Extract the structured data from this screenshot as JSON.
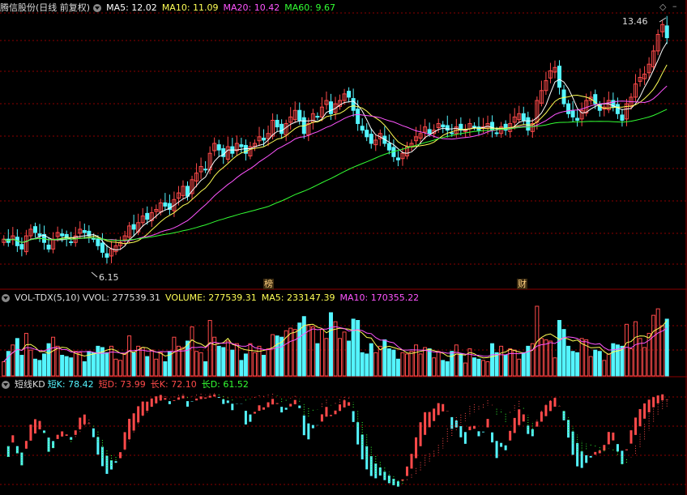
{
  "header": {
    "stock": "腾信股份(日线 前复权)",
    "ma5": "MA5: 12.02",
    "ma10": "MA10: 11.09",
    "ma20": "MA20: 10.42",
    "ma60": "MA60: 9.67"
  },
  "volume_header": {
    "name": "VOL-TDX(5,10)",
    "vvol": "VVOL: 277539.31",
    "volume": "VOLUME: 277539.31",
    "ma5": "MA5: 233147.39",
    "ma10": "MA10: 170355.22"
  },
  "kd_header": {
    "name": "短线KD",
    "shortk": "短K: 78.42",
    "shortd": "短D: 73.99",
    "longk": "长K: 72.10",
    "longd": "长D: 61.52"
  },
  "price_labels": {
    "high": "13.46",
    "low": "6.15"
  },
  "markers": {
    "bang": "榜",
    "cai": "财"
  },
  "controls": {
    "diamond": "◇",
    "minus": "–"
  },
  "colors": {
    "up": "#ff4a4a",
    "down": "#54f5ff",
    "ma5": "#ffffff",
    "ma10": "#ffff55",
    "ma20": "#ff55ff",
    "ma60": "#33ff33",
    "grid": "#8b0000"
  },
  "chart_data": [
    {
      "type": "candlestick",
      "title": "腾信股份(日线 前复权)",
      "series": [
        {
          "name": "MA5",
          "values": [
            12.02
          ]
        },
        {
          "name": "MA10",
          "values": [
            11.09
          ]
        },
        {
          "name": "MA20",
          "values": [
            10.42
          ]
        },
        {
          "name": "MA60",
          "values": [
            9.67
          ]
        }
      ],
      "close": [
        6.7,
        6.6,
        6.8,
        6.5,
        6.4,
        6.8,
        7.0,
        6.9,
        6.8,
        6.6,
        6.4,
        6.7,
        6.9,
        6.8,
        6.7,
        6.6,
        6.8,
        7.0,
        6.9,
        6.8,
        6.7,
        6.5,
        6.3,
        6.15,
        6.4,
        6.5,
        6.6,
        6.8,
        7.1,
        7.0,
        7.2,
        7.4,
        7.3,
        7.5,
        7.6,
        7.8,
        7.7,
        7.6,
        7.9,
        8.1,
        8.3,
        8.0,
        8.5,
        8.7,
        8.9,
        8.8,
        9.3,
        9.6,
        9.4,
        9.2,
        9.5,
        9.3,
        9.6,
        9.5,
        9.3,
        9.5,
        9.6,
        9.8,
        9.7,
        9.9,
        10.3,
        10.1,
        9.9,
        10.2,
        10.4,
        10.6,
        10.3,
        9.9,
        10.2,
        10.5,
        10.4,
        10.7,
        10.9,
        10.5,
        10.8,
        10.9,
        11.1,
        11.0,
        10.6,
        10.2,
        10.0,
        9.8,
        9.6,
        9.7,
        9.9,
        9.6,
        9.4,
        9.2,
        9.1,
        9.3,
        9.5,
        9.6,
        9.8,
        9.9,
        10.1,
        9.9,
        10.0,
        10.2,
        10.1,
        10.0,
        9.9,
        10.1,
        10.0,
        10.0,
        10.2,
        10.1,
        10.0,
        10.1,
        10.2,
        10.0,
        9.9,
        10.1,
        10.0,
        10.2,
        10.4,
        10.5,
        10.3,
        10.0,
        10.2,
        10.9,
        11.2,
        11.5,
        11.8,
        11.9,
        11.3,
        10.8,
        10.5,
        10.4,
        10.3,
        10.6,
        10.9,
        11.0,
        10.8,
        10.6,
        10.7,
        10.9,
        10.7,
        10.5,
        10.3,
        10.8,
        11.0,
        11.4,
        11.6,
        11.7,
        12.0,
        12.4,
        12.9,
        13.2,
        12.8
      ],
      "high": 13.46,
      "low": 6.15
    },
    {
      "type": "bar",
      "title": "VOL-TDX(5,10)",
      "series": [
        {
          "name": "VVOL",
          "values": [
            277539.31
          ]
        },
        {
          "name": "VOLUME",
          "values": [
            277539.31
          ]
        },
        {
          "name": "MA5",
          "values": [
            233147.39
          ]
        },
        {
          "name": "MA10",
          "values": [
            170355.22
          ]
        }
      ]
    },
    {
      "type": "line",
      "title": "短线KD",
      "series": [
        {
          "name": "短K",
          "values": [
            78.42
          ]
        },
        {
          "name": "短D",
          "values": [
            73.99
          ]
        },
        {
          "name": "长K",
          "values": [
            72.1
          ]
        },
        {
          "name": "长D",
          "values": [
            61.52
          ]
        }
      ]
    }
  ]
}
